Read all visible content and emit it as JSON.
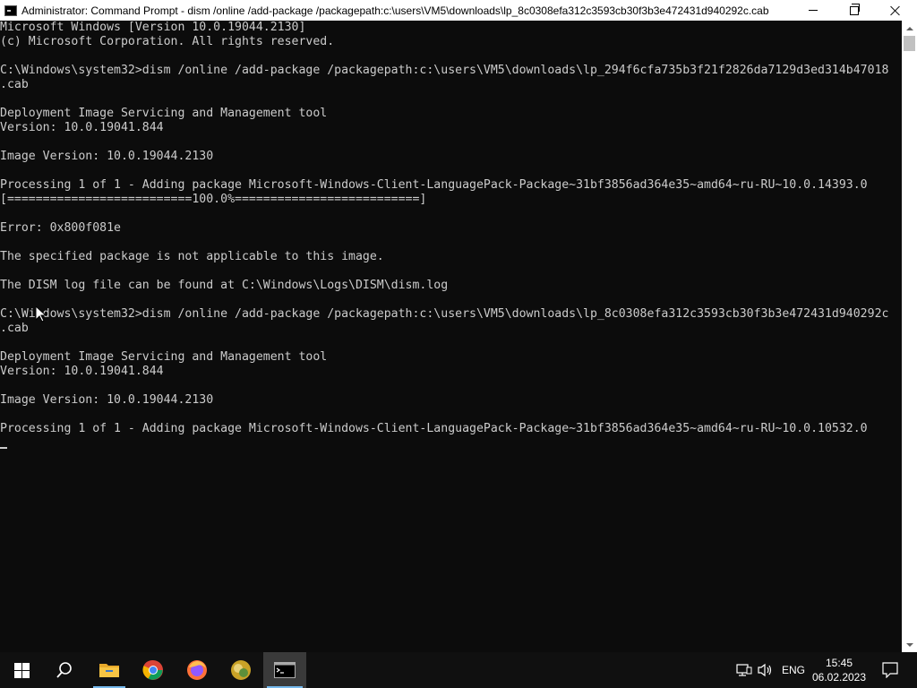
{
  "window": {
    "title": "Administrator:  Command Prompt - dism  /online /add-package /packagepath:c:\\users\\VM5\\downloads\\lp_8c0308efa312c3593cb30f3b3e472431d940292c.cab",
    "app_icon": "cmd-icon",
    "buttons": {
      "minimize": "minimize-icon",
      "maximize": "restore-icon",
      "close": "close-icon"
    }
  },
  "console": {
    "lines": [
      "Microsoft Windows [Version 10.0.19044.2130]",
      "(c) Microsoft Corporation. All rights reserved.",
      "",
      "C:\\Windows\\system32>dism /online /add-package /packagepath:c:\\users\\VM5\\downloads\\lp_294f6cfa735b3f21f2826da7129d3ed314b47018",
      ".cab",
      "",
      "Deployment Image Servicing and Management tool",
      "Version: 10.0.19041.844",
      "",
      "Image Version: 10.0.19044.2130",
      "",
      "Processing 1 of 1 - Adding package Microsoft-Windows-Client-LanguagePack-Package~31bf3856ad364e35~amd64~ru-RU~10.0.14393.0",
      "[==========================100.0%==========================]",
      "",
      "Error: 0x800f081e",
      "",
      "The specified package is not applicable to this image.",
      "",
      "The DISM log file can be found at C:\\Windows\\Logs\\DISM\\dism.log",
      "",
      "C:\\Windows\\system32>dism /online /add-package /packagepath:c:\\users\\VM5\\downloads\\lp_8c0308efa312c3593cb30f3b3e472431d940292c",
      ".cab",
      "",
      "Deployment Image Servicing and Management tool",
      "Version: 10.0.19041.844",
      "",
      "Image Version: 10.0.19044.2130",
      "",
      "Processing 1 of 1 - Adding package Microsoft-Windows-Client-LanguagePack-Package~31bf3856ad364e35~amd64~ru-RU~10.0.10532.0"
    ]
  },
  "taskbar": {
    "items": [
      "windows-start-icon",
      "search-icon",
      "file-explorer-icon",
      "chrome-icon",
      "firefox-icon",
      "app-icon",
      "command-prompt-icon"
    ],
    "tray": {
      "language": "ENG",
      "time": "15:45",
      "date": "06.02.2023"
    }
  },
  "colors": {
    "console_bg": "#0c0c0c",
    "console_text": "#cccccc",
    "taskbar_bg": "#101010",
    "active_indicator": "#76b9ed"
  }
}
